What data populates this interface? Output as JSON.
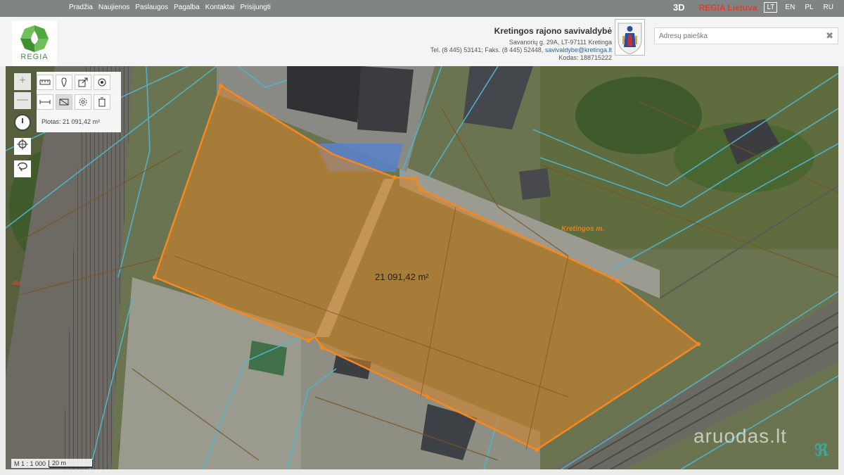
{
  "topnav": {
    "items": [
      "Pradžia",
      "Naujienos",
      "Paslaugos",
      "Pagalba",
      "Kontaktai",
      "Prisijungti"
    ]
  },
  "topright": {
    "three_d": "3D",
    "regia_lietuva": "REGIA Lietuva",
    "languages": [
      "LT",
      "EN",
      "PL",
      "RU"
    ],
    "active_language": "LT"
  },
  "logo": {
    "text": "REGIA"
  },
  "municipality": {
    "name": "Kretingos rajono savivaldybė",
    "address": "Savanorių g. 29A, LT-97111 Kretinga",
    "contacts_prefix": "Tel. (8 445) 53141; Faks. (8 445) 52448, ",
    "email": "savivaldybe@kretinga.lt",
    "code": "Kodas: 188715222"
  },
  "search": {
    "placeholder": "Adresų paieška",
    "value": ""
  },
  "map": {
    "tools": {
      "zoom_in": "+",
      "zoom_out": "—",
      "icons": [
        "ruler-icon",
        "marker-icon",
        "export-icon",
        "target-icon",
        "measure-line-icon",
        "measure-area-icon",
        "settings-icon",
        "trash-icon"
      ]
    },
    "measurement": "Plotas: 21 091,42 m²",
    "area_label": "21 091,42 m²",
    "street_label": "Kretingos m.",
    "parcel_number": "48A",
    "scale_ratio": "M 1 : 1 000",
    "scale_distance": "20 m",
    "watermark": "aruodas.lt"
  },
  "colors": {
    "topbar": "#7f8585",
    "accent_red": "#e53b2b",
    "polygon_stroke": "#f5891f",
    "polygon_fill": "#d98324",
    "cadastre_lines": "#4fb5cf"
  }
}
